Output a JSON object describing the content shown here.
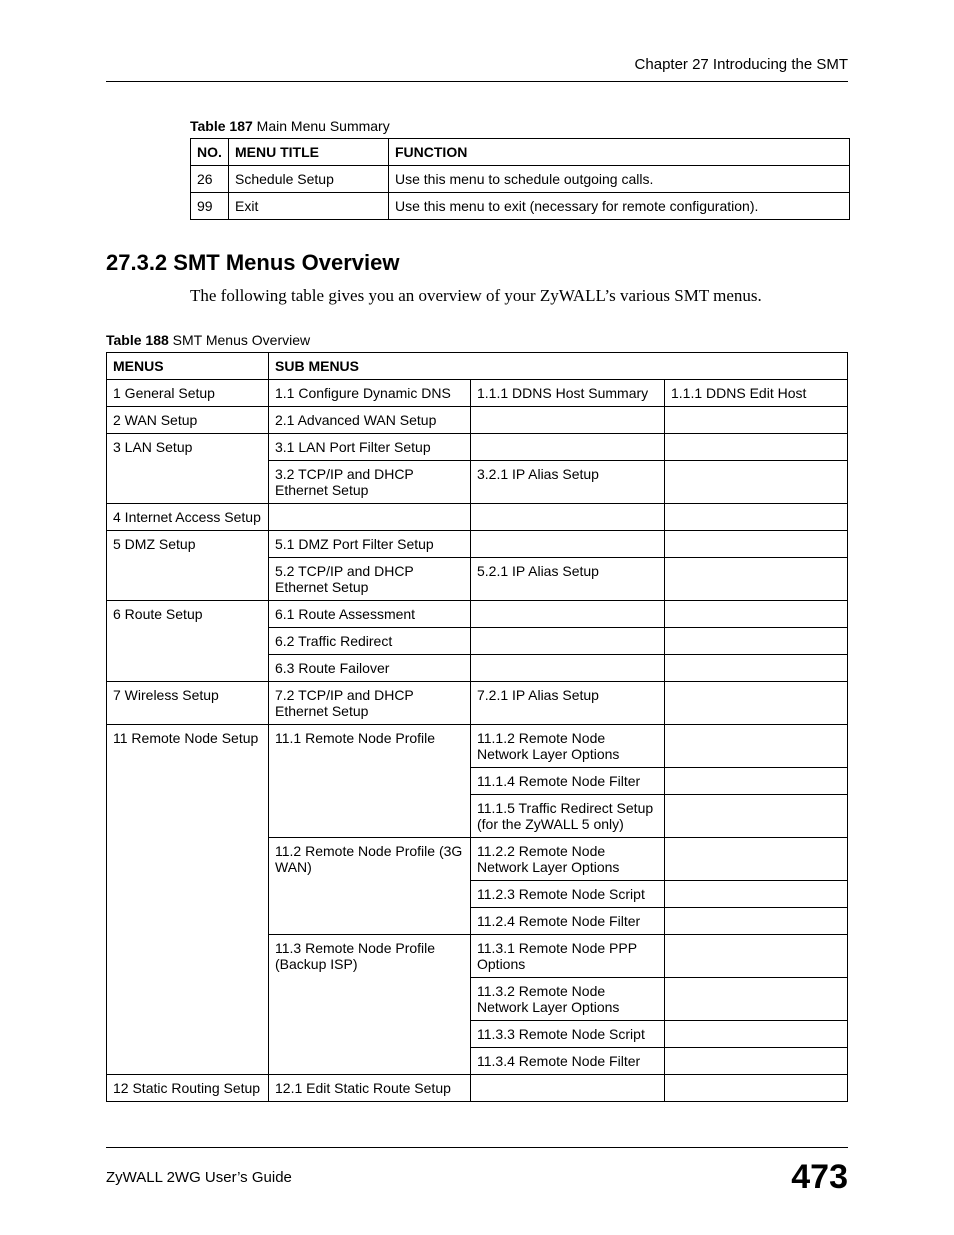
{
  "chapterHeader": "Chapter 27 Introducing the SMT",
  "table187": {
    "captionBold": "Table 187",
    "captionRest": "   Main Menu Summary",
    "headers": {
      "no": "NO.",
      "title": "MENU TITLE",
      "func": "FUNCTION"
    },
    "rows": [
      {
        "no": "26",
        "title": "Schedule Setup",
        "func": "Use this menu to schedule outgoing calls."
      },
      {
        "no": "99",
        "title": "Exit",
        "func": "Use this menu to exit (necessary for remote configuration)."
      }
    ]
  },
  "sectionHeading": "27.3.2  SMT Menus Overview",
  "introText": "The following table gives you an overview of your ZyWALL’s various SMT menus.",
  "table188": {
    "captionBold": "Table 188",
    "captionRest": "   SMT Menus Overview",
    "headers": {
      "menus": "MENUS",
      "submenus": "SUB MENUS"
    },
    "rows": [
      {
        "c0": "1 General Setup",
        "c1": "1.1 Configure Dynamic DNS",
        "c2": "1.1.1 DDNS Host Summary",
        "c3": "1.1.1 DDNS Edit Host"
      },
      {
        "c0": "2 WAN Setup",
        "c1": "2.1 Advanced WAN Setup",
        "c2": "",
        "c3": ""
      },
      {
        "c0": "3 LAN Setup",
        "c1": "3.1 LAN Port Filter Setup",
        "c2": "",
        "c3": "",
        "rs0": 2
      },
      {
        "c1": "3.2 TCP/IP and DHCP Ethernet Setup",
        "c2": "3.2.1 IP Alias Setup",
        "c3": ""
      },
      {
        "c0": "4 Internet Access Setup",
        "c1": "",
        "c2": "",
        "c3": ""
      },
      {
        "c0": "5 DMZ Setup",
        "c1": "5.1 DMZ Port Filter Setup",
        "c2": "",
        "c3": "",
        "rs0": 2
      },
      {
        "c1": "5.2 TCP/IP and DHCP Ethernet Setup",
        "c2": "5.2.1 IP Alias Setup",
        "c3": ""
      },
      {
        "c0": "6 Route Setup",
        "c1": "6.1 Route Assessment",
        "c2": "",
        "c3": "",
        "rs0": 3
      },
      {
        "c1": "6.2 Traffic Redirect",
        "c2": "",
        "c3": ""
      },
      {
        "c1": "6.3 Route Failover",
        "c2": "",
        "c3": ""
      },
      {
        "c0": "7 Wireless Setup",
        "c1": "7.2 TCP/IP and DHCP Ethernet Setup",
        "c2": "7.2.1 IP Alias Setup",
        "c3": ""
      },
      {
        "c0": "11 Remote Node Setup",
        "c1": "11.1 Remote Node Profile",
        "c2": "11.1.2 Remote Node Network Layer Options",
        "c3": "",
        "rs0": 10,
        "rs1": 3
      },
      {
        "c2": "11.1.4 Remote Node Filter",
        "c3": ""
      },
      {
        "c2": "11.1.5 Traffic Redirect Setup (for the ZyWALL 5 only)",
        "c3": ""
      },
      {
        "c1": "11.2  Remote Node Profile (3G WAN)",
        "c2": "11.2.2 Remote Node Network Layer Options",
        "c3": "",
        "rs1": 3
      },
      {
        "c2": "11.2.3 Remote Node Script",
        "c3": ""
      },
      {
        "c2": "11.2.4 Remote Node Filter",
        "c3": ""
      },
      {
        "c1": "11.3 Remote Node Profile (Backup ISP)",
        "c2": "11.3.1 Remote Node PPP Options",
        "c3": "",
        "rs1": 4
      },
      {
        "c2": "11.3.2 Remote Node Network Layer Options",
        "c3": ""
      },
      {
        "c2": "11.3.3 Remote Node Script",
        "c3": ""
      },
      {
        "c2": "11.3.4 Remote Node Filter",
        "c3": ""
      },
      {
        "c0": "12 Static Routing Setup",
        "c1": "12.1 Edit Static Route Setup",
        "c2": "",
        "c3": ""
      }
    ]
  },
  "footer": {
    "guide": "ZyWALL 2WG User’s Guide",
    "page": "473"
  }
}
